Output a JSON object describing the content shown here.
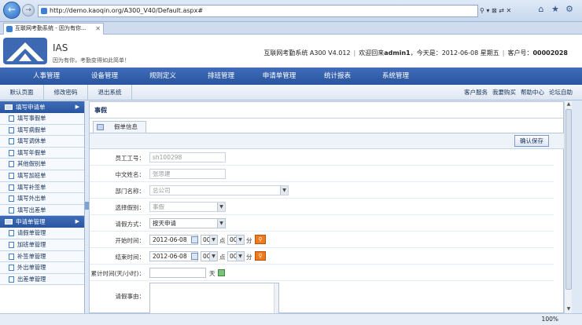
{
  "browser": {
    "url": "http://demo.kaoqin.org/A300_V40/Default.aspx#",
    "tab_title": "互联网考勤系统 - 因为有你...",
    "addr_tools": "⚲ ▾ ⊠ ⇄ ✕",
    "zoom": "100%"
  },
  "header": {
    "brand": "IAS",
    "slogan": "因为有你，考勤变得如此简单！",
    "system_name": "互联网考勤系统  A300 V4.012",
    "welcome_prefix": "欢迎回来",
    "user": "admin1",
    "date_prefix": "，今天是：2012-06-08 星期五",
    "customer_label": "客户号：",
    "customer_no": "00002028"
  },
  "main_nav": [
    "人事管理",
    "设备管理",
    "规则定义",
    "排班管理",
    "申请单管理",
    "统计报表",
    "系统管理"
  ],
  "sub_bar": {
    "buttons": [
      "默认页面",
      "修改密码",
      "退出系统"
    ],
    "links": [
      "客户服务",
      "我要购买",
      "帮助中心",
      "论坛自助"
    ]
  },
  "sidebar": {
    "group1": "填写申请单",
    "group1_items": [
      "填写事假单",
      "填写病假单",
      "填写调休单",
      "填写年假单",
      "其他假别单",
      "填写加班单",
      "填写补签单",
      "填写外出单",
      "填写出差单"
    ],
    "group2": "申请单管理",
    "group2_items": [
      "请假单管理",
      "加班单管理",
      "补签单管理",
      "外出单管理",
      "出差单管理"
    ]
  },
  "content": {
    "title": "事假",
    "tab_label": "假单信息",
    "save_label": "确认保存",
    "fields": {
      "emp_no_label": "员工工号：",
      "emp_no_value": "sh100298",
      "name_label": "中文姓名：",
      "name_value": "张思建",
      "dept_label": "部门名称：",
      "dept_value": "总公司",
      "leave_type_label": "选择假别：",
      "leave_type_value": "事假",
      "method_label": "请假方式：",
      "method_value": "按天申请",
      "start_label": "开始时间：",
      "start_date": "2012-06-08",
      "start_hour": "00",
      "start_min": "00",
      "end_label": "结束时间：",
      "end_date": "2012-06-08",
      "end_hour": "00",
      "end_min": "00",
      "hour_unit": "点",
      "min_unit": "分",
      "total_label": "累计时间(天/小时)：",
      "total_value": "",
      "total_unit": "天",
      "reason_label": "请假事由："
    }
  }
}
